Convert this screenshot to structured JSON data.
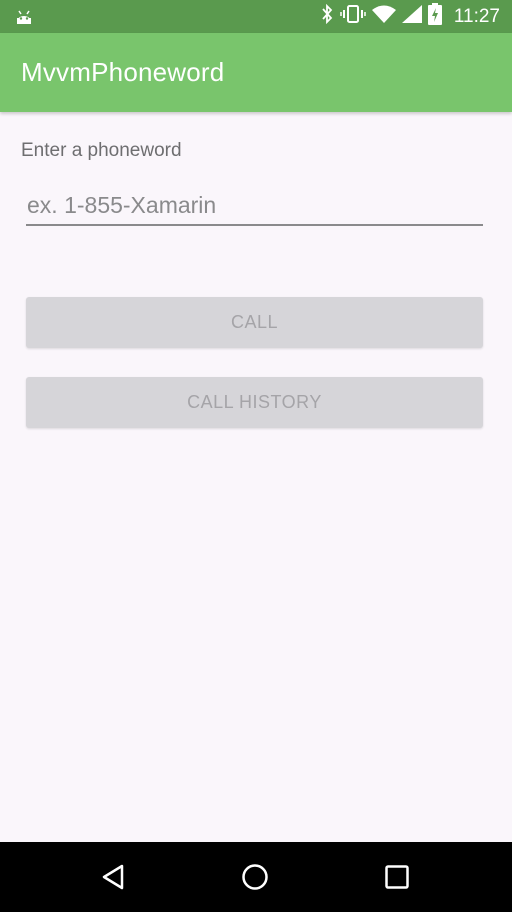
{
  "status_bar": {
    "time": "11:27",
    "icons": [
      "android-icon",
      "bluetooth-icon",
      "vibrate-icon",
      "wifi-icon",
      "signal-icon",
      "battery-charging-icon"
    ]
  },
  "app_bar": {
    "title": "MvvmPhoneword"
  },
  "form": {
    "label": "Enter a phoneword",
    "input_value": "",
    "input_placeholder": "ex. 1-855-Xamarin",
    "call_label": "CALL",
    "history_label": "CALL HISTORY"
  },
  "nav_bar": {
    "icons": [
      "back-icon",
      "home-icon",
      "recents-icon"
    ]
  },
  "colors": {
    "status_bar": "#5a9a4e",
    "app_bar": "#79c56c",
    "background": "#faf6fb",
    "button_disabled": "#d6d5d9",
    "button_text_disabled": "#a5a4a8"
  }
}
